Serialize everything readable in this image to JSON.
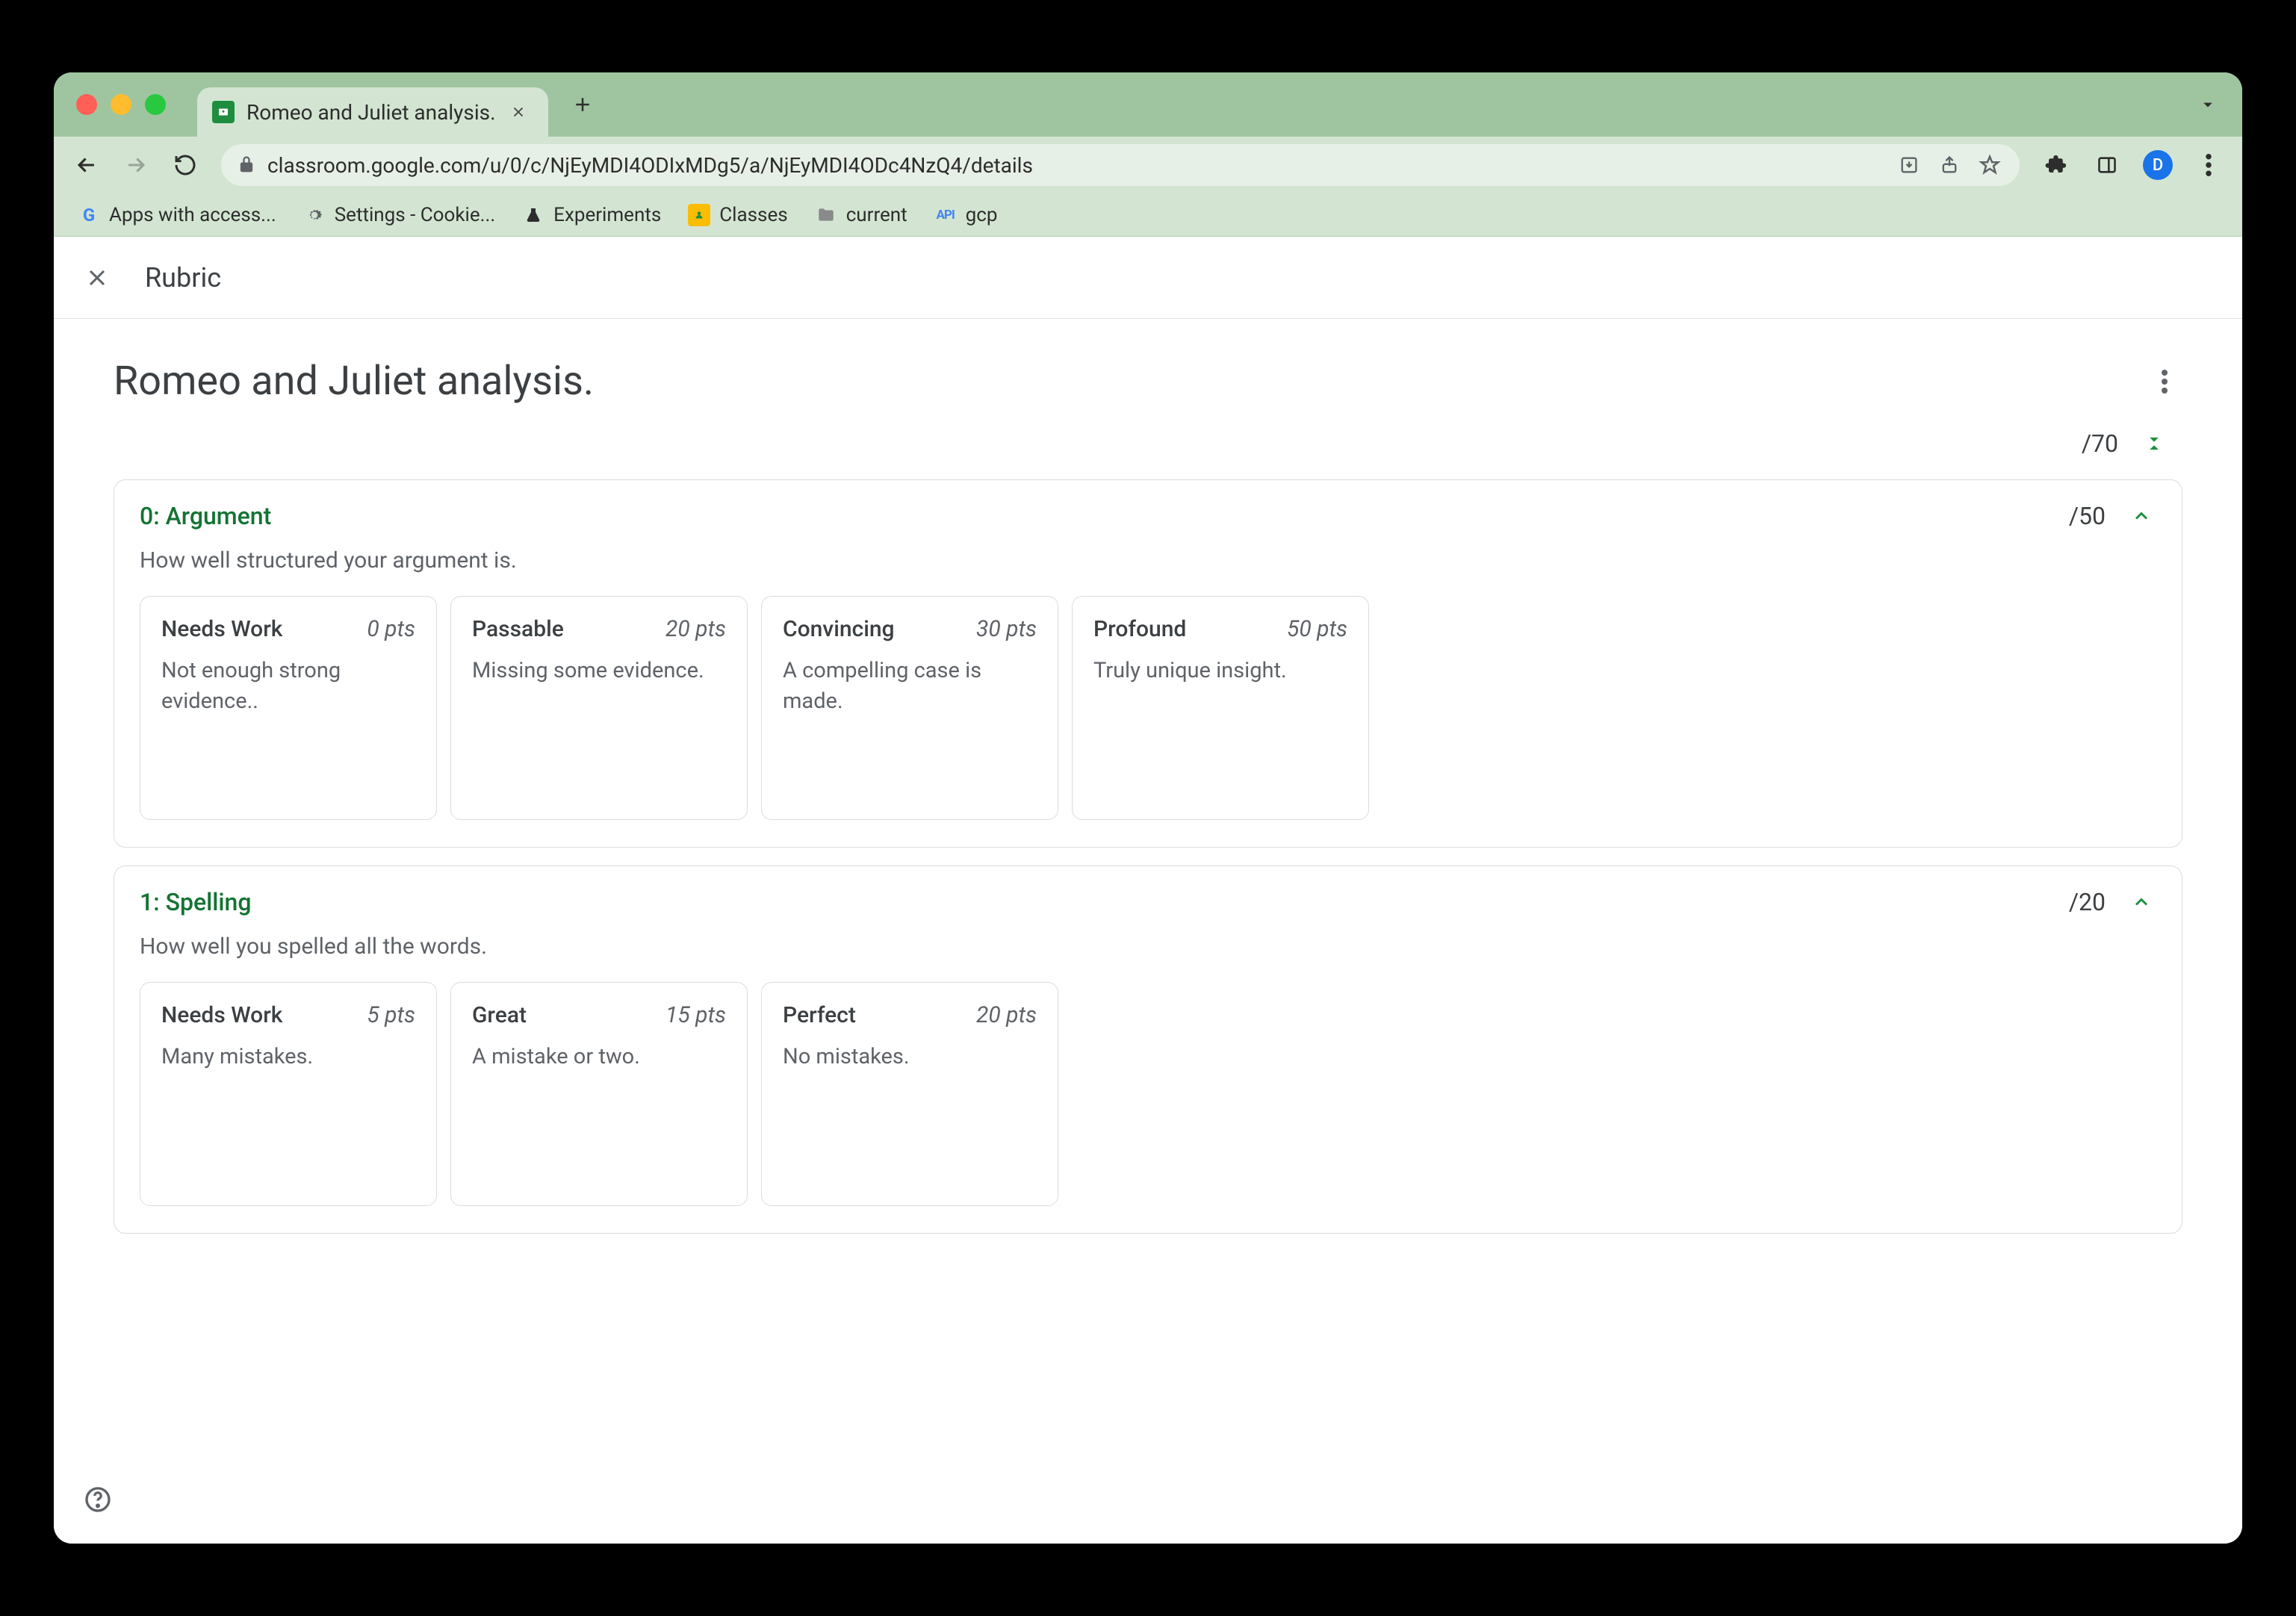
{
  "browser": {
    "tab_title": "Romeo and Juliet analysis.",
    "url": "classroom.google.com/u/0/c/NjEyMDI4ODIxMDg5/a/NjEyMDI4ODc4NzQ4/details",
    "profile_initial": "D",
    "bookmarks": [
      {
        "label": "Apps with access..."
      },
      {
        "label": "Settings - Cookie..."
      },
      {
        "label": "Experiments"
      },
      {
        "label": "Classes"
      },
      {
        "label": "current"
      },
      {
        "label": "gcp",
        "prefix": "API"
      }
    ]
  },
  "app_bar": {
    "title": "Rubric"
  },
  "rubric": {
    "title": "Romeo and Juliet analysis.",
    "total_points": "/70",
    "criteria": [
      {
        "title": "0: Argument",
        "points": "/50",
        "description": "How well structured your argument is.",
        "levels": [
          {
            "title": "Needs Work",
            "points": "0 pts",
            "description": "Not enough strong evidence.."
          },
          {
            "title": "Passable",
            "points": "20 pts",
            "description": "Missing some evidence."
          },
          {
            "title": "Convincing",
            "points": "30 pts",
            "description": "A compelling case is made."
          },
          {
            "title": "Profound",
            "points": "50 pts",
            "description": "Truly unique insight."
          }
        ]
      },
      {
        "title": "1: Spelling",
        "points": "/20",
        "description": "How well you spelled all the words.",
        "levels": [
          {
            "title": "Needs Work",
            "points": "5 pts",
            "description": "Many mistakes."
          },
          {
            "title": "Great",
            "points": "15 pts",
            "description": "A mistake or two."
          },
          {
            "title": "Perfect",
            "points": "20 pts",
            "description": "No mistakes."
          }
        ]
      }
    ]
  }
}
